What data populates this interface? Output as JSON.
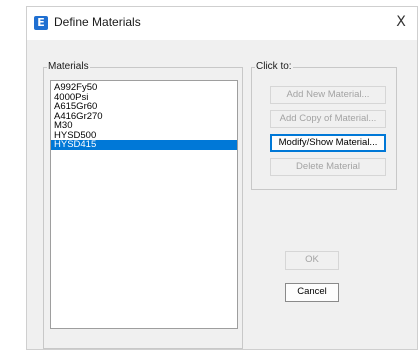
{
  "window": {
    "title": "Define Materials",
    "icon_letter": "E",
    "close_glyph": "X"
  },
  "materials": {
    "label": "Materials",
    "items": [
      "A992Fy50",
      "4000Psi",
      "A615Gr60",
      "A416Gr270",
      "M30",
      "HYSD500",
      "HYSD415"
    ],
    "selected": "HYSD415"
  },
  "click_to": {
    "label": "Click to:",
    "add_new": "Add New Material...",
    "add_copy": "Add Copy of Material...",
    "modify_show": "Modify/Show Material...",
    "delete": "Delete Material"
  },
  "footer": {
    "ok": "OK",
    "cancel": "Cancel"
  },
  "colors": {
    "selection": "#0078d7",
    "icon": "#1f6fd1"
  }
}
